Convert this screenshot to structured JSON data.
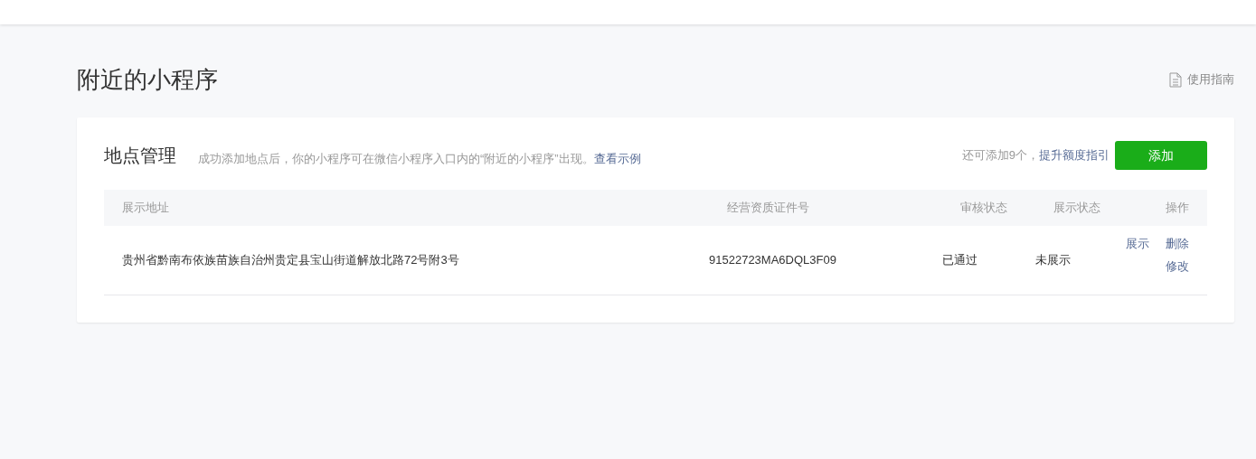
{
  "page_title": "附近的小程序",
  "guide_link": "使用指南",
  "card": {
    "title": "地点管理",
    "description": "成功添加地点后，你的小程序可在微信小程序入口内的“附近的小程序”出现。",
    "example_link": "查看示例",
    "quota_text": "还可添加9个，",
    "quota_link": "提升额度指引",
    "add_button": "添加"
  },
  "table": {
    "columns": [
      "展示地址",
      "经营资质证件号",
      "审核状态",
      "展示状态",
      "操作"
    ],
    "rows": [
      {
        "address": "贵州省黔南布依族苗族自治州贵定县宝山街道解放北路72号附3号",
        "license": "91522723MA6DQL3F09",
        "review_status": "已通过",
        "display_status": "未展示",
        "actions": [
          "展示",
          "删除",
          "修改"
        ]
      }
    ]
  }
}
